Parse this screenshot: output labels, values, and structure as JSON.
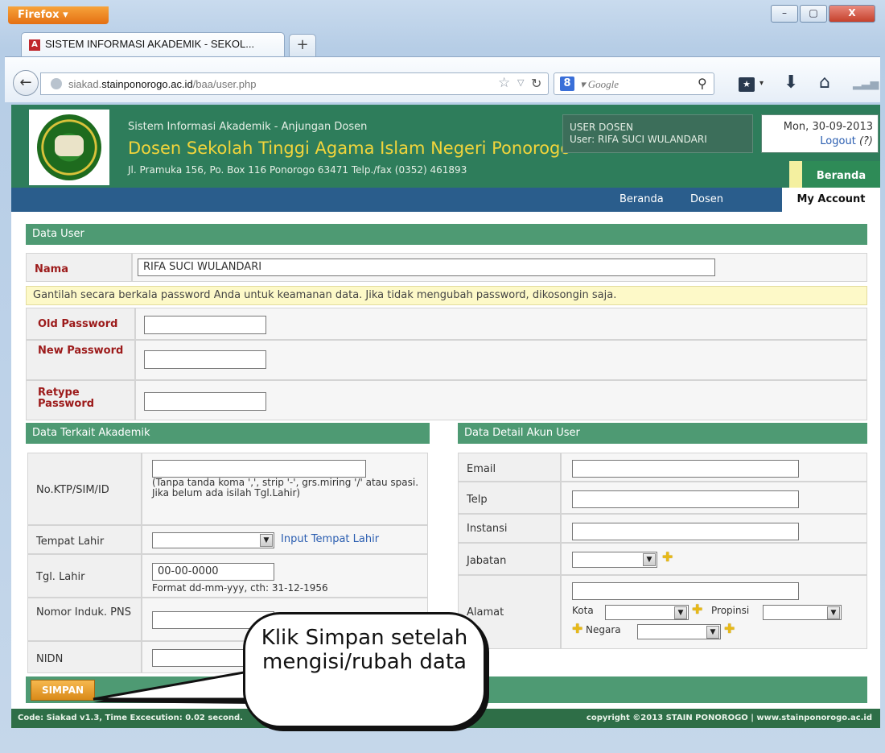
{
  "browser": {
    "app_button": "Firefox ▾",
    "tab_title": "SISTEM INFORMASI AKADEMIK - SEKOL...",
    "tab_icon": "A",
    "new_tab": "+",
    "url_domain_prefix": "siakad.",
    "url_domain": "stainponorogo.ac.id",
    "url_path": "/baa/user.php",
    "search_engine_icon": "8",
    "search_placeholder": "▾ Google",
    "window_controls": [
      "–",
      "▢",
      "X"
    ]
  },
  "site": {
    "subtitle": "Sistem Informasi Akademik - Anjungan Dosen",
    "title": "Dosen Sekolah Tinggi Agama Islam Negeri Ponorogo",
    "address": "Jl. Pramuka 156, Po. Box 116 Ponorogo 63471 Telp./fax (0352) 461893",
    "user_role": "USER DOSEN",
    "user_name": "User: RIFA SUCI WULANDARI",
    "date": "Mon, 30-09-2013",
    "logout": "Logout",
    "logout_help": "(?)",
    "beranda_tab": "Beranda",
    "menu": [
      "Beranda",
      "Dosen"
    ],
    "menu_active": "My Account"
  },
  "data_user": {
    "header": "Data User",
    "nama_label": "Nama",
    "nama_value": "RIFA SUCI WULANDARI",
    "notice": "Gantilah secara berkala password Anda untuk keamanan data. Jika tidak mengubah password, dikosongin saja.",
    "old_password": "Old Password",
    "new_password": "New Password",
    "retype_password": "Retype Password"
  },
  "akademik": {
    "header": "Data Terkait Akademik",
    "ktp_label": "No.KTP/SIM/ID",
    "ktp_hint": "(Tanpa tanda koma ',', strip '-', grs.miring '/' atau spasi. Jika belum ada isilah Tgl.Lahir)",
    "tempat_label": "Tempat Lahir",
    "tempat_link": "Input Tempat Lahir",
    "tgl_label": "Tgl. Lahir",
    "tgl_value": "00-00-0000",
    "tgl_hint": "Format dd-mm-yyy, cth: 31-12-1956",
    "nip_label": "Nomor Induk. PNS",
    "nidn_label": "NIDN"
  },
  "detail_akun": {
    "header": "Data Detail Akun User",
    "email_label": "Email",
    "telp_label": "Telp",
    "instansi_label": "Instansi",
    "jabatan_label": "Jabatan",
    "alamat_label": "Alamat",
    "kota_label": "Kota",
    "propinsi_label": "Propinsi",
    "negara_label": "Negara"
  },
  "simpan_label": "SIMPAN",
  "callout_text": "Klik Simpan setelah mengisi/rubah data",
  "footer": {
    "left": "Code: Siakad v1.3, Time Excecution: 0.02 second.",
    "right": "copyright ©2013 STAIN PONOROGO | www.stainponorogo.ac.id"
  },
  "colors": {
    "header_green": "#2e7d5b",
    "title_yellow": "#f2d53b",
    "menu_blue": "#2a5d8c",
    "section_green": "#4e9a73",
    "button_orange": "#e89a2a"
  }
}
